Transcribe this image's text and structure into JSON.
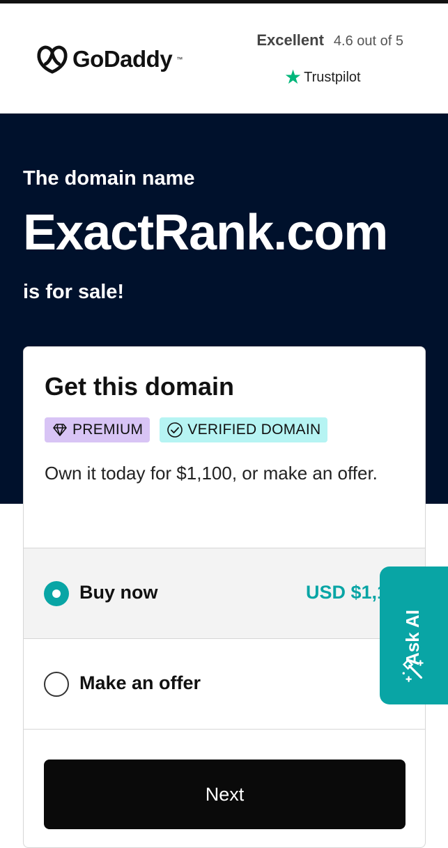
{
  "header": {
    "logo_text": "GoDaddy",
    "logo_tm": "™",
    "rating_label": "Excellent",
    "rating_score": "4.6 out of 5",
    "trustpilot": "Trustpilot"
  },
  "hero": {
    "pre": "The domain name",
    "domain": "ExactRank.com",
    "post": "is for sale!"
  },
  "card": {
    "title": "Get this domain",
    "badge_premium": "PREMIUM",
    "badge_verified": "VERIFIED DOMAIN",
    "description": "Own it today for $1,100, or make an offer.",
    "options": [
      {
        "label": "Buy now",
        "price": "USD $1,1",
        "selected": true
      },
      {
        "label": "Make an offer",
        "selected": false
      }
    ],
    "next_label": "Next"
  },
  "ask_ai": {
    "label": "Ask AI"
  },
  "colors": {
    "hero_bg": "#00112c",
    "accent_teal": "#09a5a5",
    "premium_badge": "#d8c4f5",
    "verified_badge": "#b6f4f3",
    "trustpilot_green": "#00b67a"
  },
  "icons": [
    "godaddy-logo-icon",
    "trustpilot-star-icon",
    "diamond-icon",
    "check-circle-icon",
    "magic-wand-icon"
  ]
}
